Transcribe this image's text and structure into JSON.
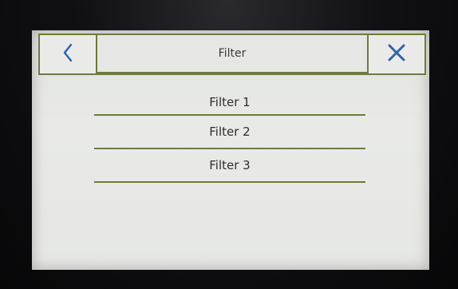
{
  "header": {
    "title": "Filter",
    "back_icon": "chevron-left-icon",
    "close_icon": "close-icon"
  },
  "filters": [
    {
      "label": "Filter 1"
    },
    {
      "label": "Filter 2"
    },
    {
      "label": "Filter 3"
    }
  ],
  "colors": {
    "accent_line": "#6e7b3c",
    "icon_blue": "#2f64a8",
    "screen_bg": "#e6e7e5",
    "bezel": "#0d0d0f"
  }
}
